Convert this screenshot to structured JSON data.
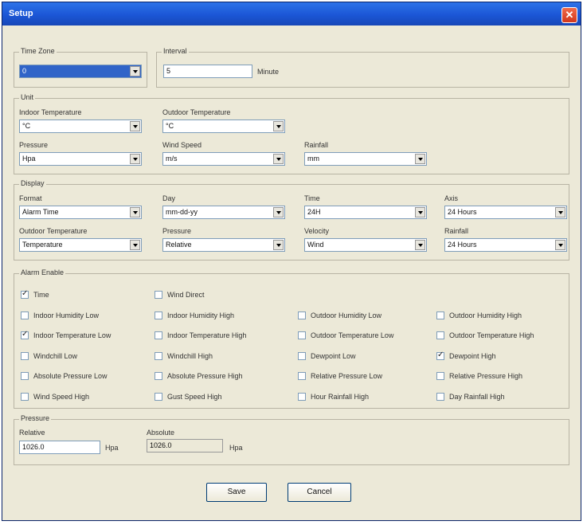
{
  "window": {
    "title": "Setup",
    "close_glyph": "✕"
  },
  "time_zone": {
    "title": "Time Zone",
    "value": "0"
  },
  "interval": {
    "title": "Interval",
    "value": "5",
    "unit": "Minute"
  },
  "unit": {
    "title": "Unit",
    "indoor_temperature": {
      "label": "Indoor Temperature",
      "value": "°C"
    },
    "outdoor_temperature": {
      "label": "Outdoor Temperature",
      "value": "°C"
    },
    "pressure": {
      "label": "Pressure",
      "value": "Hpa"
    },
    "wind_speed": {
      "label": "Wind Speed",
      "value": "m/s"
    },
    "rainfall": {
      "label": "Rainfall",
      "value": "mm"
    }
  },
  "display": {
    "title": "Display",
    "format": {
      "label": "Format",
      "value": "Alarm Time"
    },
    "day": {
      "label": "Day",
      "value": "mm-dd-yy"
    },
    "time": {
      "label": "Time",
      "value": "24H"
    },
    "axis": {
      "label": "Axis",
      "value": "24 Hours"
    },
    "outdoor_temperature": {
      "label": "Outdoor Temperature",
      "value": "Temperature"
    },
    "pressure": {
      "label": "Pressure",
      "value": "Relative"
    },
    "velocity": {
      "label": "Velocity",
      "value": "Wind"
    },
    "rainfall": {
      "label": "Rainfall",
      "value": "24 Hours"
    }
  },
  "alarm": {
    "title": "Alarm Enable",
    "items": [
      {
        "label": "Time",
        "checked": true
      },
      {
        "label": "Wind Direct",
        "checked": false
      },
      {
        "label": "Indoor Humidity Low",
        "checked": false
      },
      {
        "label": "Indoor Humidity High",
        "checked": false
      },
      {
        "label": "Outdoor Humidity Low",
        "checked": false
      },
      {
        "label": "Outdoor Humidity High",
        "checked": false
      },
      {
        "label": "Indoor Temperature Low",
        "checked": true
      },
      {
        "label": "Indoor Temperature High",
        "checked": false
      },
      {
        "label": "Outdoor Temperature Low",
        "checked": false
      },
      {
        "label": "Outdoor Temperature High",
        "checked": false
      },
      {
        "label": "Windchill Low",
        "checked": false
      },
      {
        "label": "Windchill High",
        "checked": false
      },
      {
        "label": "Dewpoint Low",
        "checked": false
      },
      {
        "label": "Dewpoint High",
        "checked": true
      },
      {
        "label": "Absolute Pressure Low",
        "checked": false
      },
      {
        "label": "Absolute Pressure High",
        "checked": false
      },
      {
        "label": "Relative Pressure Low",
        "checked": false
      },
      {
        "label": "Relative Pressure High",
        "checked": false
      },
      {
        "label": "Wind Speed High",
        "checked": false
      },
      {
        "label": "Gust Speed High",
        "checked": false
      },
      {
        "label": "Hour Rainfall High",
        "checked": false
      },
      {
        "label": "Day Rainfall High",
        "checked": false
      }
    ]
  },
  "pressure_box": {
    "title": "Pressure",
    "relative": {
      "label": "Relative",
      "value": "1026.0",
      "unit": "Hpa"
    },
    "absolute": {
      "label": "Absolute",
      "value": "1026.0",
      "unit": "Hpa"
    }
  },
  "buttons": {
    "save": "Save",
    "cancel": "Cancel"
  },
  "colors": {
    "titlebar": "#1b56d6",
    "dialog_bg": "#ece9d8",
    "selection": "#3064c8"
  }
}
